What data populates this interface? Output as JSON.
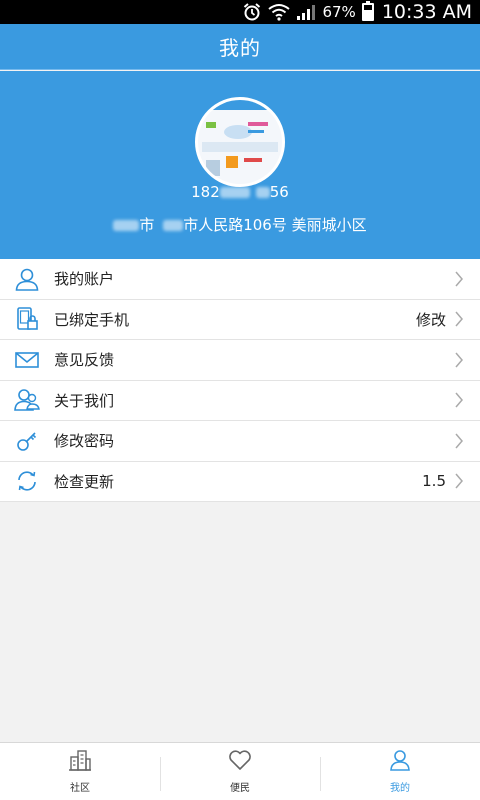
{
  "status_bar": {
    "battery_percent": "67%",
    "battery_level": 0.67,
    "time": "10:33 AM",
    "icons": [
      "alarm-icon",
      "wifi-icon",
      "signal-icon",
      "battery-icon"
    ]
  },
  "header": {
    "title": "我的"
  },
  "profile": {
    "phone_prefix": "182",
    "phone_suffix": "56",
    "address_part1": "市",
    "address_part2": "市人民路106号 美丽城小区"
  },
  "menu": [
    {
      "label": "我的账户",
      "value": "",
      "icon": "user-icon"
    },
    {
      "label": "已绑定手机",
      "value": "修改",
      "icon": "phone-lock-icon"
    },
    {
      "label": "意见反馈",
      "value": "",
      "icon": "mail-icon"
    },
    {
      "label": "关于我们",
      "value": "",
      "icon": "users-icon"
    },
    {
      "label": "修改密码",
      "value": "",
      "icon": "key-icon"
    },
    {
      "label": "检查更新",
      "value": "1.5",
      "icon": "refresh-icon"
    }
  ],
  "bottom_nav": [
    {
      "label": "社区",
      "icon": "buildings-icon",
      "active": false
    },
    {
      "label": "便民",
      "icon": "heart-icon",
      "active": false
    },
    {
      "label": "我的",
      "icon": "person-icon",
      "active": true
    }
  ],
  "colors": {
    "accent": "#3a9ae0",
    "icon_blue": "#2e8fd8"
  }
}
